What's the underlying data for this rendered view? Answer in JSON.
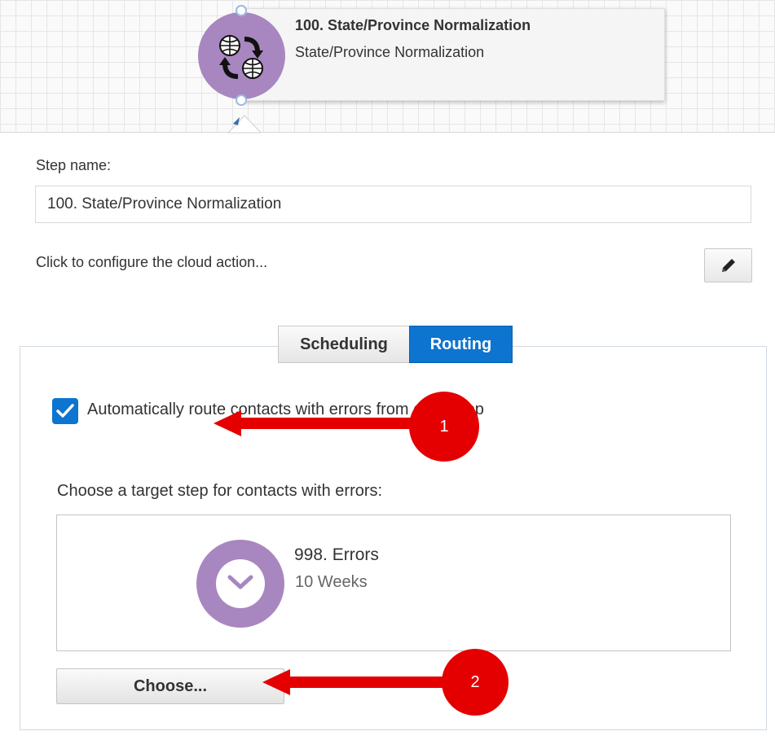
{
  "node": {
    "title": "100. State/Province Normalization",
    "subtitle": "State/Province Normalization",
    "icon": "globe-transform-icon",
    "color": "#a887c0"
  },
  "form": {
    "step_name_label": "Step name:",
    "step_name_value": "100. State/Province Normalization",
    "configure_text": "Click to configure the cloud action...",
    "edit_icon": "pencil-icon"
  },
  "tabs": [
    {
      "label": "Scheduling",
      "active": false
    },
    {
      "label": "Routing",
      "active": true
    }
  ],
  "routing": {
    "auto_route_checked": true,
    "auto_route_text": "Automatically route contacts with errors from cloud app",
    "choose_target_label": "Choose a target step for contacts with errors:",
    "target": {
      "title": "998. Errors",
      "subtitle": "10 Weeks",
      "icon": "chevron-down-icon"
    },
    "choose_button": "Choose..."
  },
  "annotations": [
    {
      "number": "1"
    },
    {
      "number": "2"
    }
  ],
  "colors": {
    "accent": "#0d74cf",
    "annotation": "#e40000",
    "node": "#a887c0"
  }
}
